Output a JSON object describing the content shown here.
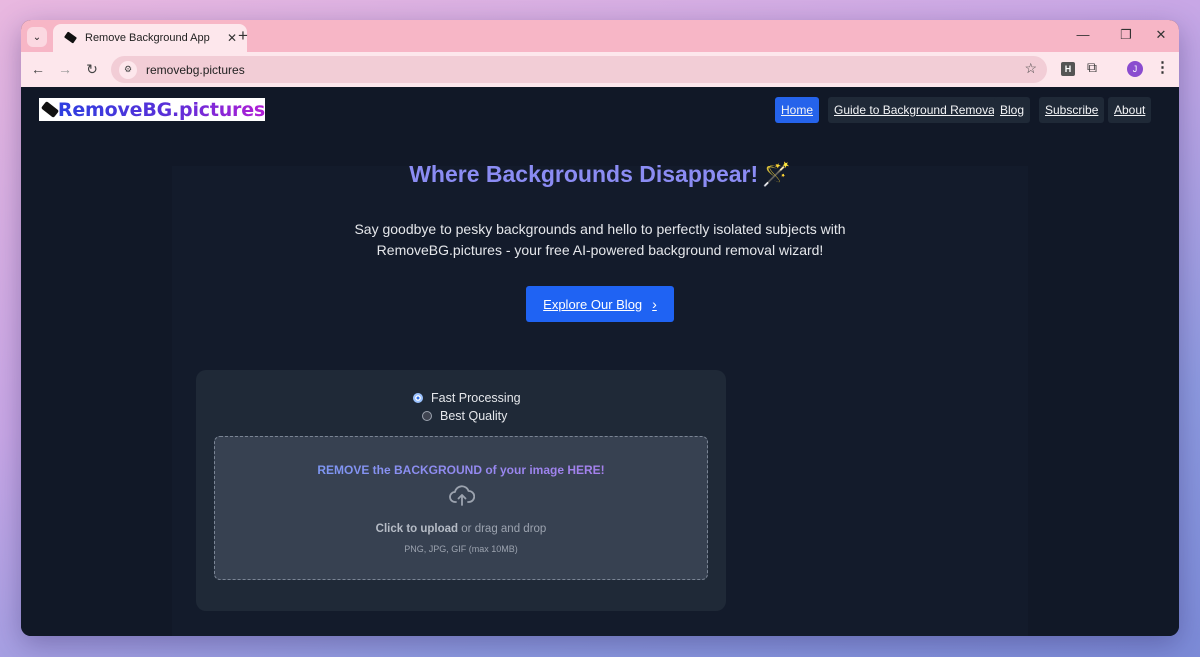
{
  "browser": {
    "tab_title": "Remove Background App",
    "url": "removebg.pictures",
    "profile_initial": "J",
    "extension_label": "H"
  },
  "site": {
    "logo_text": "RemoveBG.pictures",
    "nav": [
      {
        "label": "Home",
        "active": true
      },
      {
        "label": "Guide to Background Removal",
        "active": false
      },
      {
        "label": "Blog",
        "active": false
      },
      {
        "label": "Subscribe",
        "active": false
      },
      {
        "label": "About",
        "active": false
      }
    ]
  },
  "hero": {
    "title": "Where Backgrounds Disappear!",
    "subtitle": "Say goodbye to pesky backgrounds and hello to perfectly isolated subjects with RemoveBG.pictures - your free AI-powered background removal wizard!",
    "cta_label": "Explore Our Blog"
  },
  "uploader": {
    "options": [
      {
        "label": "Fast Processing",
        "selected": true
      },
      {
        "label": "Best Quality",
        "selected": false
      }
    ],
    "dropzone_title": "REMOVE the BACKGROUND of your image HERE!",
    "click_to_upload": "Click to upload",
    "drag_text": "or drag and drop",
    "formats": "PNG, JPG, GIF (max 10MB)"
  },
  "colors": {
    "page_bg": "#111827",
    "card_bg": "#1f2937",
    "accent": "#2563eb",
    "title_color": "#8b8cf3"
  }
}
